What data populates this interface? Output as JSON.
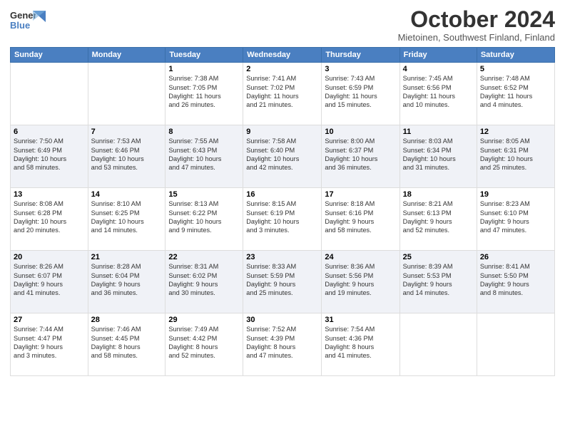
{
  "logo": {
    "line1": "General",
    "line2": "Blue"
  },
  "title": "October 2024",
  "subtitle": "Mietoinen, Southwest Finland, Finland",
  "headers": [
    "Sunday",
    "Monday",
    "Tuesday",
    "Wednesday",
    "Thursday",
    "Friday",
    "Saturday"
  ],
  "weeks": [
    [
      {
        "day": "",
        "info": ""
      },
      {
        "day": "",
        "info": ""
      },
      {
        "day": "1",
        "info": "Sunrise: 7:38 AM\nSunset: 7:05 PM\nDaylight: 11 hours\nand 26 minutes."
      },
      {
        "day": "2",
        "info": "Sunrise: 7:41 AM\nSunset: 7:02 PM\nDaylight: 11 hours\nand 21 minutes."
      },
      {
        "day": "3",
        "info": "Sunrise: 7:43 AM\nSunset: 6:59 PM\nDaylight: 11 hours\nand 15 minutes."
      },
      {
        "day": "4",
        "info": "Sunrise: 7:45 AM\nSunset: 6:56 PM\nDaylight: 11 hours\nand 10 minutes."
      },
      {
        "day": "5",
        "info": "Sunrise: 7:48 AM\nSunset: 6:52 PM\nDaylight: 11 hours\nand 4 minutes."
      }
    ],
    [
      {
        "day": "6",
        "info": "Sunrise: 7:50 AM\nSunset: 6:49 PM\nDaylight: 10 hours\nand 58 minutes."
      },
      {
        "day": "7",
        "info": "Sunrise: 7:53 AM\nSunset: 6:46 PM\nDaylight: 10 hours\nand 53 minutes."
      },
      {
        "day": "8",
        "info": "Sunrise: 7:55 AM\nSunset: 6:43 PM\nDaylight: 10 hours\nand 47 minutes."
      },
      {
        "day": "9",
        "info": "Sunrise: 7:58 AM\nSunset: 6:40 PM\nDaylight: 10 hours\nand 42 minutes."
      },
      {
        "day": "10",
        "info": "Sunrise: 8:00 AM\nSunset: 6:37 PM\nDaylight: 10 hours\nand 36 minutes."
      },
      {
        "day": "11",
        "info": "Sunrise: 8:03 AM\nSunset: 6:34 PM\nDaylight: 10 hours\nand 31 minutes."
      },
      {
        "day": "12",
        "info": "Sunrise: 8:05 AM\nSunset: 6:31 PM\nDaylight: 10 hours\nand 25 minutes."
      }
    ],
    [
      {
        "day": "13",
        "info": "Sunrise: 8:08 AM\nSunset: 6:28 PM\nDaylight: 10 hours\nand 20 minutes."
      },
      {
        "day": "14",
        "info": "Sunrise: 8:10 AM\nSunset: 6:25 PM\nDaylight: 10 hours\nand 14 minutes."
      },
      {
        "day": "15",
        "info": "Sunrise: 8:13 AM\nSunset: 6:22 PM\nDaylight: 10 hours\nand 9 minutes."
      },
      {
        "day": "16",
        "info": "Sunrise: 8:15 AM\nSunset: 6:19 PM\nDaylight: 10 hours\nand 3 minutes."
      },
      {
        "day": "17",
        "info": "Sunrise: 8:18 AM\nSunset: 6:16 PM\nDaylight: 9 hours\nand 58 minutes."
      },
      {
        "day": "18",
        "info": "Sunrise: 8:21 AM\nSunset: 6:13 PM\nDaylight: 9 hours\nand 52 minutes."
      },
      {
        "day": "19",
        "info": "Sunrise: 8:23 AM\nSunset: 6:10 PM\nDaylight: 9 hours\nand 47 minutes."
      }
    ],
    [
      {
        "day": "20",
        "info": "Sunrise: 8:26 AM\nSunset: 6:07 PM\nDaylight: 9 hours\nand 41 minutes."
      },
      {
        "day": "21",
        "info": "Sunrise: 8:28 AM\nSunset: 6:04 PM\nDaylight: 9 hours\nand 36 minutes."
      },
      {
        "day": "22",
        "info": "Sunrise: 8:31 AM\nSunset: 6:02 PM\nDaylight: 9 hours\nand 30 minutes."
      },
      {
        "day": "23",
        "info": "Sunrise: 8:33 AM\nSunset: 5:59 PM\nDaylight: 9 hours\nand 25 minutes."
      },
      {
        "day": "24",
        "info": "Sunrise: 8:36 AM\nSunset: 5:56 PM\nDaylight: 9 hours\nand 19 minutes."
      },
      {
        "day": "25",
        "info": "Sunrise: 8:39 AM\nSunset: 5:53 PM\nDaylight: 9 hours\nand 14 minutes."
      },
      {
        "day": "26",
        "info": "Sunrise: 8:41 AM\nSunset: 5:50 PM\nDaylight: 9 hours\nand 8 minutes."
      }
    ],
    [
      {
        "day": "27",
        "info": "Sunrise: 7:44 AM\nSunset: 4:47 PM\nDaylight: 9 hours\nand 3 minutes."
      },
      {
        "day": "28",
        "info": "Sunrise: 7:46 AM\nSunset: 4:45 PM\nDaylight: 8 hours\nand 58 minutes."
      },
      {
        "day": "29",
        "info": "Sunrise: 7:49 AM\nSunset: 4:42 PM\nDaylight: 8 hours\nand 52 minutes."
      },
      {
        "day": "30",
        "info": "Sunrise: 7:52 AM\nSunset: 4:39 PM\nDaylight: 8 hours\nand 47 minutes."
      },
      {
        "day": "31",
        "info": "Sunrise: 7:54 AM\nSunset: 4:36 PM\nDaylight: 8 hours\nand 41 minutes."
      },
      {
        "day": "",
        "info": ""
      },
      {
        "day": "",
        "info": ""
      }
    ]
  ]
}
